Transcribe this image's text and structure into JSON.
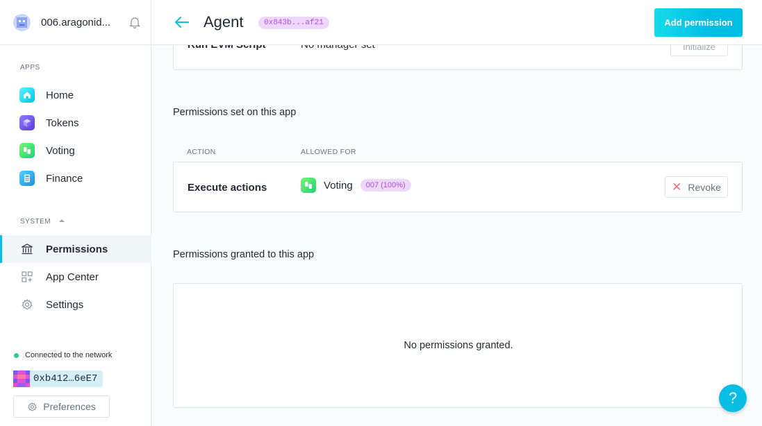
{
  "sidebar": {
    "org_name": "006.aragonid...",
    "apps_title": "APPS",
    "apps": [
      {
        "label": "Home",
        "icon": "home-icon"
      },
      {
        "label": "Tokens",
        "icon": "tokens-icon"
      },
      {
        "label": "Voting",
        "icon": "voting-icon"
      },
      {
        "label": "Finance",
        "icon": "finance-icon"
      }
    ],
    "system_title": "SYSTEM",
    "system": [
      {
        "label": "Permissions",
        "icon": "bank-icon",
        "active": true
      },
      {
        "label": "App Center",
        "icon": "app-center-icon"
      },
      {
        "label": "Settings",
        "icon": "gear-icon"
      }
    ],
    "network_status": "Connected to the network",
    "account_address": "0xb412…6eE7",
    "preferences_label": "Preferences"
  },
  "header": {
    "title": "Agent",
    "address_badge": "0x843b...af21",
    "add_button_label": "Add permission"
  },
  "partial_row": {
    "action": "Run EVM Script",
    "manager": "No manager set",
    "button": "Initialize"
  },
  "permissions_set": {
    "title": "Permissions set on this app",
    "col_action": "ACTION",
    "col_allowed": "ALLOWED FOR",
    "rows": [
      {
        "action": "Execute actions",
        "entity": "Voting",
        "badge": "007 (100%)",
        "revoke_label": "Revoke"
      }
    ]
  },
  "permissions_granted": {
    "title": "Permissions granted to this app",
    "empty_message": "No permissions granted."
  },
  "help_label": "?",
  "colors": {
    "accent": "#08bee5",
    "badge_bg": "#edd8fb",
    "badge_text": "#b14de3",
    "network_dot": "#2ccb86"
  }
}
